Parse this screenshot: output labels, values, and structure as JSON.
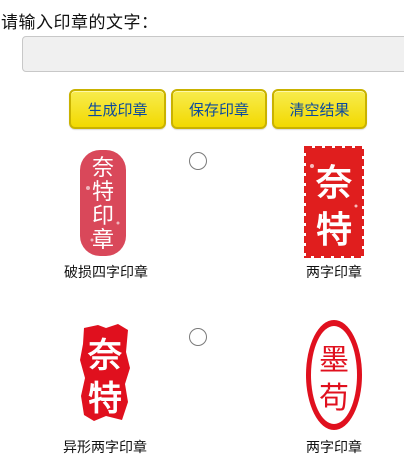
{
  "prompt_label": "请输入印章的文字：",
  "input": {
    "value": "",
    "placeholder": ""
  },
  "buttons": {
    "generate": "生成印章",
    "save": "保存印章",
    "clear": "清空结果"
  },
  "seals": [
    {
      "caption": "破损四字印章",
      "chars": [
        "奈",
        "特",
        "印",
        "章"
      ],
      "color": "#d9485a",
      "selected": false
    },
    {
      "caption": "两字印章",
      "chars": [
        "奈",
        "特"
      ],
      "color": "#e01e1e",
      "selected": false
    },
    {
      "caption": "异形两字印章",
      "chars": [
        "奈",
        "特"
      ],
      "color": "#e0101e",
      "selected": false
    },
    {
      "caption": "两字印章",
      "chars": [
        "墨",
        "苟"
      ],
      "color": "#e0101e",
      "selected": false
    }
  ]
}
